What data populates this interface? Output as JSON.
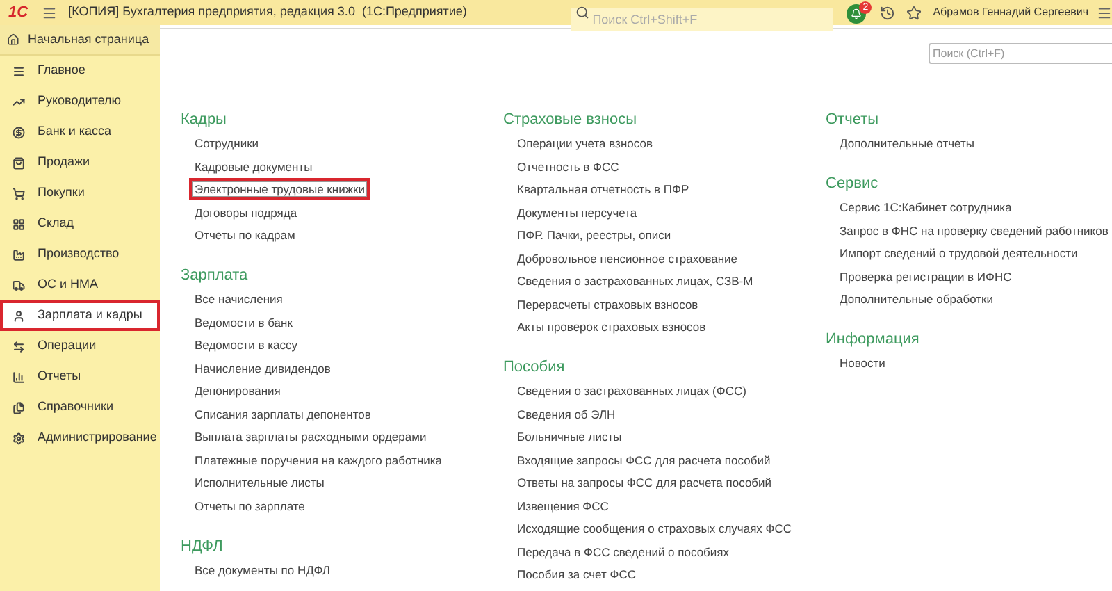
{
  "window": {
    "logo": "1С",
    "title": "[КОПИЯ] Бухгалтерия предприятия, редакция 3.0  (1С:Предприятие)"
  },
  "global_search": {
    "placeholder": "Поиск Ctrl+Shift+F"
  },
  "notifications": {
    "count": "2"
  },
  "user": "Абрамов Геннадий Сергеевич",
  "home_tab": "Начальная страница",
  "sidebar": {
    "items": [
      {
        "label": "Главное",
        "selected": false
      },
      {
        "label": "Руководителю",
        "selected": false
      },
      {
        "label": "Банк и касса",
        "selected": false
      },
      {
        "label": "Продажи",
        "selected": false
      },
      {
        "label": "Покупки",
        "selected": false
      },
      {
        "label": "Склад",
        "selected": false
      },
      {
        "label": "Производство",
        "selected": false
      },
      {
        "label": "ОС и НМА",
        "selected": false
      },
      {
        "label": "Зарплата и кадры",
        "selected": true
      },
      {
        "label": "Операции",
        "selected": false
      },
      {
        "label": "Отчеты",
        "selected": false
      },
      {
        "label": "Справочники",
        "selected": false
      },
      {
        "label": "Администрирование",
        "selected": false
      }
    ]
  },
  "content": {
    "search": {
      "placeholder": "Поиск (Ctrl+F)"
    },
    "columns": [
      [
        {
          "heading": "Кадры",
          "links": [
            {
              "label": "Сотрудники",
              "highlighted": false
            },
            {
              "label": "Кадровые документы",
              "highlighted": false
            },
            {
              "label": "Электронные трудовые книжки",
              "highlighted": true
            },
            {
              "label": "Договоры подряда",
              "highlighted": false
            },
            {
              "label": "Отчеты по кадрам",
              "highlighted": false
            }
          ]
        },
        {
          "heading": "Зарплата",
          "links": [
            {
              "label": "Все начисления",
              "highlighted": false
            },
            {
              "label": "Ведомости в банк",
              "highlighted": false
            },
            {
              "label": "Ведомости в кассу",
              "highlighted": false
            },
            {
              "label": "Начисление дивидендов",
              "highlighted": false
            },
            {
              "label": "Депонирования",
              "highlighted": false
            },
            {
              "label": "Списания зарплаты депонентов",
              "highlighted": false
            },
            {
              "label": "Выплата зарплаты расходными ордерами",
              "highlighted": false
            },
            {
              "label": "Платежные поручения на каждого работника",
              "highlighted": false
            },
            {
              "label": "Исполнительные листы",
              "highlighted": false
            },
            {
              "label": "Отчеты по зарплате",
              "highlighted": false
            }
          ]
        },
        {
          "heading": "НДФЛ",
          "links": [
            {
              "label": "Все документы по НДФЛ",
              "highlighted": false
            }
          ]
        }
      ],
      [
        {
          "heading": "Страховые взносы",
          "links": [
            {
              "label": "Операции учета взносов",
              "highlighted": false
            },
            {
              "label": "Отчетность в ФСС",
              "highlighted": false
            },
            {
              "label": "Квартальная отчетность в ПФР",
              "highlighted": false
            },
            {
              "label": "Документы персучета",
              "highlighted": false
            },
            {
              "label": "ПФР. Пачки, реестры, описи",
              "highlighted": false
            },
            {
              "label": "Добровольное пенсионное страхование",
              "highlighted": false
            },
            {
              "label": "Сведения о застрахованных лицах, СЗВ-М",
              "highlighted": false
            },
            {
              "label": "Перерасчеты страховых взносов",
              "highlighted": false
            },
            {
              "label": "Акты проверок страховых взносов",
              "highlighted": false
            }
          ]
        },
        {
          "heading": "Пособия",
          "links": [
            {
              "label": "Сведения о застрахованных лицах (ФСС)",
              "highlighted": false
            },
            {
              "label": "Сведения об ЭЛН",
              "highlighted": false
            },
            {
              "label": "Больничные листы",
              "highlighted": false
            },
            {
              "label": "Входящие запросы ФСС для расчета пособий",
              "highlighted": false
            },
            {
              "label": "Ответы на запросы ФСС для расчета пособий",
              "highlighted": false
            },
            {
              "label": "Извещения ФСС",
              "highlighted": false
            },
            {
              "label": "Исходящие сообщения о страховых случаях ФСС",
              "highlighted": false
            },
            {
              "label": "Передача в ФСС сведений о пособиях",
              "highlighted": false
            },
            {
              "label": "Пособия за счет ФСС",
              "highlighted": false
            }
          ]
        }
      ],
      [
        {
          "heading": "Отчеты",
          "links": [
            {
              "label": "Дополнительные отчеты",
              "highlighted": false
            }
          ]
        },
        {
          "heading": "Сервис",
          "links": [
            {
              "label": "Сервис 1С:Кабинет сотрудника",
              "highlighted": false
            },
            {
              "label": "Запрос в ФНС на проверку сведений работников",
              "highlighted": false
            },
            {
              "label": "Импорт сведений о трудовой деятельности",
              "highlighted": false
            },
            {
              "label": "Проверка регистрации в ИФНС",
              "highlighted": false
            },
            {
              "label": "Дополнительные обработки",
              "highlighted": false
            }
          ]
        },
        {
          "heading": "Информация",
          "links": [
            {
              "label": "Новости",
              "highlighted": false
            }
          ]
        }
      ]
    ]
  }
}
